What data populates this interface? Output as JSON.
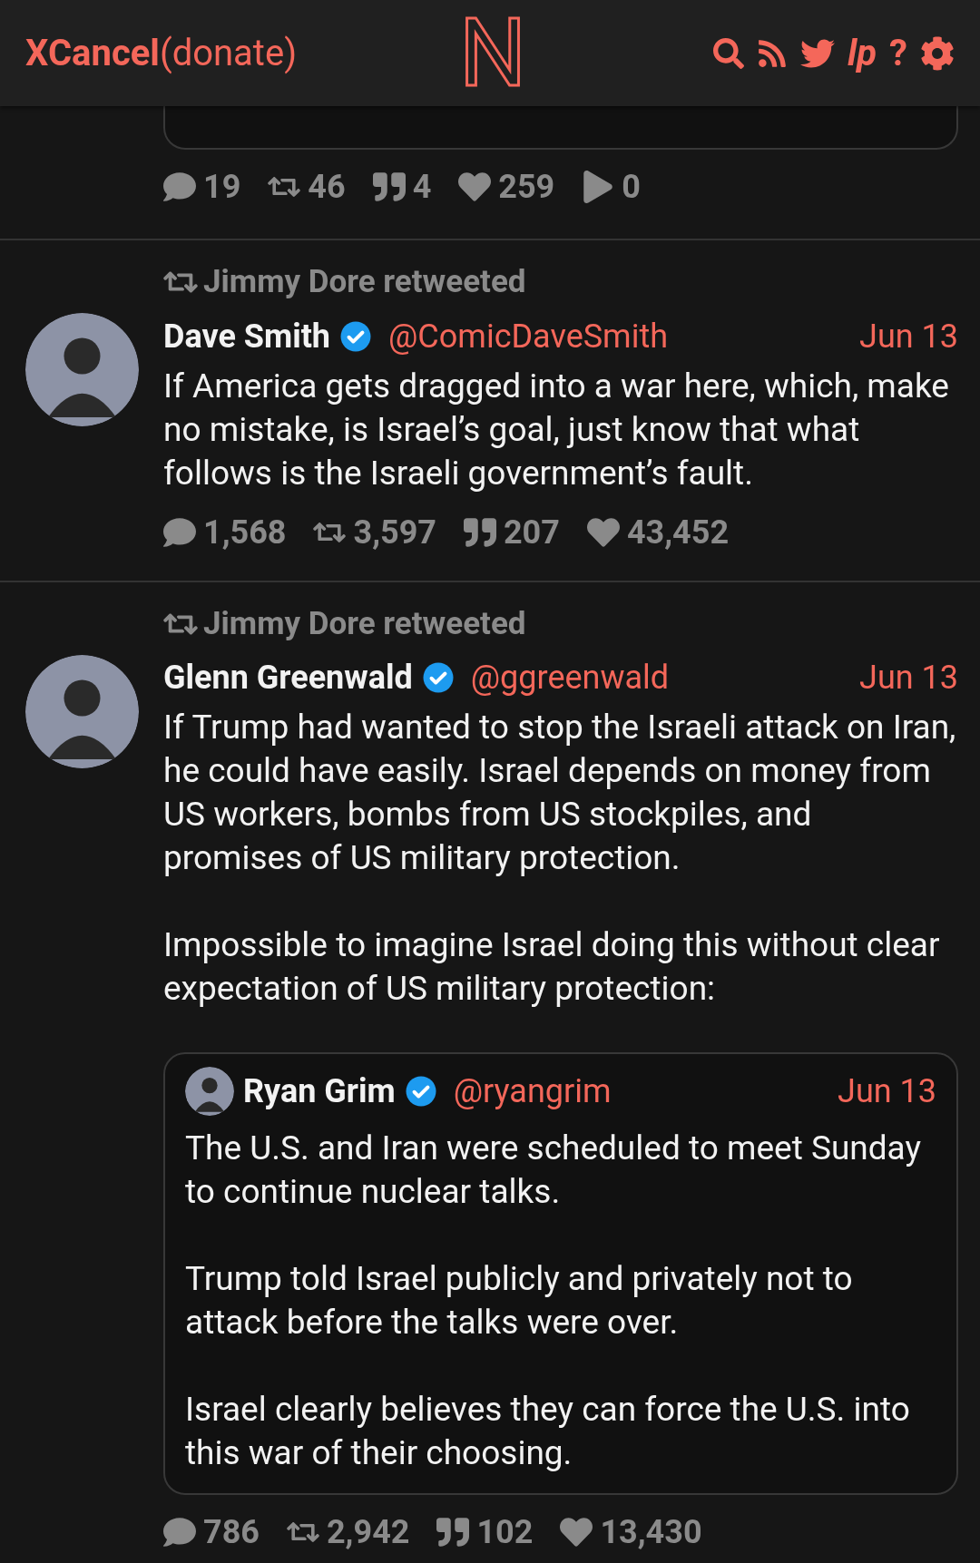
{
  "header": {
    "brand": "XCancel",
    "donate": "(donate)",
    "logo": "N",
    "icon_texts": [
      "lp",
      "?"
    ]
  },
  "tweets": [
    {
      "stats": [
        {
          "kind": "replies",
          "value": "19"
        },
        {
          "kind": "retweets",
          "value": "46"
        },
        {
          "kind": "quotes",
          "value": "4"
        },
        {
          "kind": "likes",
          "value": "259"
        },
        {
          "kind": "plays",
          "value": "0"
        }
      ]
    },
    {
      "retweeted_by": "Jimmy Dore retweeted",
      "author": {
        "name": "Dave Smith",
        "verified": true,
        "handle": "@ComicDaveSmith"
      },
      "date": "Jun 13",
      "paragraphs": [
        "If America gets dragged into a war here, which, make no mistake, is Israel’s goal, just know that what follows is the Israeli government’s fault."
      ],
      "stats": [
        {
          "kind": "replies",
          "value": "1,568"
        },
        {
          "kind": "retweets",
          "value": "3,597"
        },
        {
          "kind": "quotes",
          "value": "207"
        },
        {
          "kind": "likes",
          "value": "43,452"
        }
      ]
    },
    {
      "retweeted_by": "Jimmy Dore retweeted",
      "author": {
        "name": "Glenn Greenwald",
        "verified": true,
        "handle": "@ggreenwald"
      },
      "date": "Jun 13",
      "paragraphs": [
        "If Trump had wanted to stop the Israeli attack on Iran, he could have easily. Israel depends on money from US workers, bombs from US stockpiles, and promises of US military protection.",
        "Impossible to imagine Israel doing this without clear expectation of US military protection:"
      ],
      "quote": {
        "author": {
          "name": "Ryan Grim",
          "verified": true,
          "handle": "@ryangrim"
        },
        "date": "Jun 13",
        "paragraphs": [
          "The U.S. and Iran were scheduled to meet Sunday to continue nuclear talks.",
          "Trump told Israel publicly and privately not to attack before the talks were over.",
          "Israel clearly believes they can force the U.S. into this war of their choosing."
        ]
      },
      "stats": [
        {
          "kind": "replies",
          "value": "786"
        },
        {
          "kind": "retweets",
          "value": "2,942"
        },
        {
          "kind": "quotes",
          "value": "102"
        },
        {
          "kind": "likes",
          "value": "13,430"
        }
      ]
    }
  ]
}
